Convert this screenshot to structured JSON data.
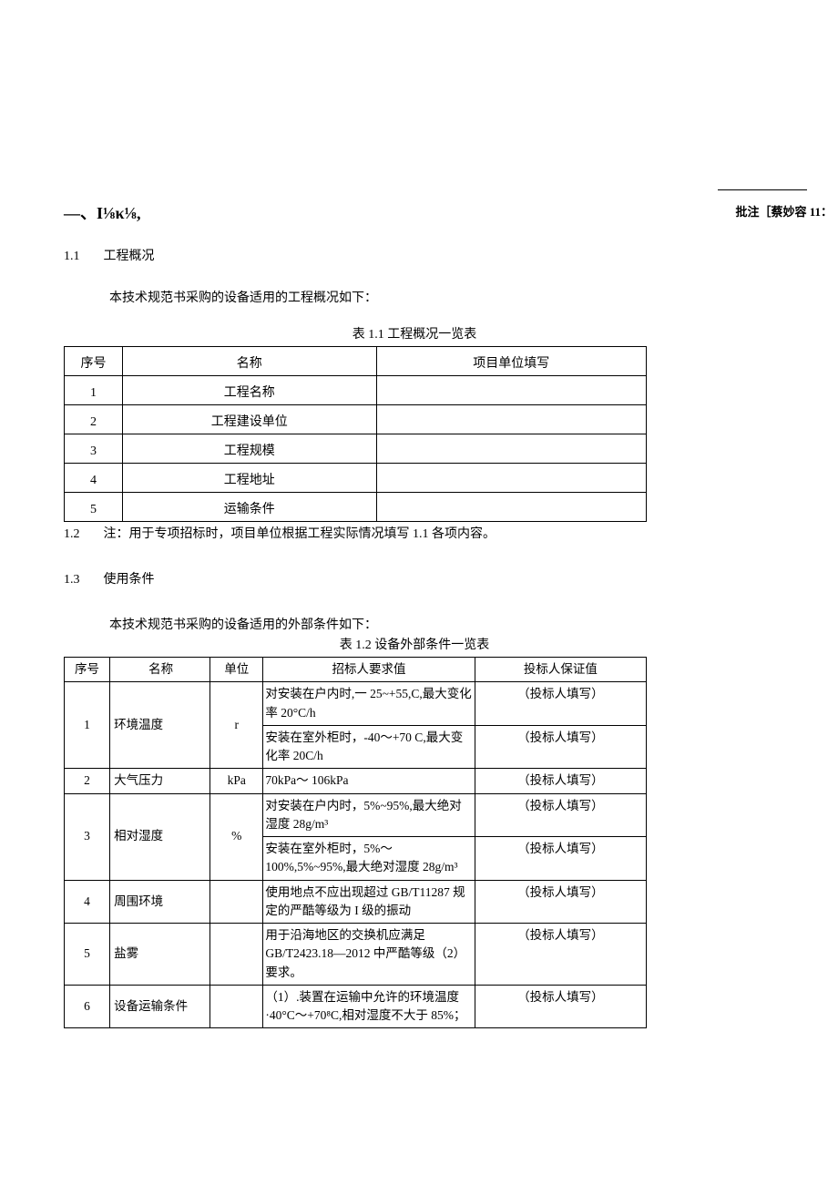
{
  "comment": {
    "label": "批注［蔡妙容 11："
  },
  "heading1": "—、I⅛κ⅛,",
  "sec11": {
    "num": "1.1",
    "title": "工程概况"
  },
  "intro11": "本技术规范书采购的设备适用的工程概况如下：",
  "table1": {
    "caption": "表 1.1 工程概况一览表",
    "headers": {
      "seq": "序号",
      "name": "名称",
      "fill": "项目单位填写"
    },
    "rows": [
      {
        "seq": "1",
        "name": "工程名称",
        "fill": ""
      },
      {
        "seq": "2",
        "name": "工程建设单位",
        "fill": ""
      },
      {
        "seq": "3",
        "name": "工程规模",
        "fill": ""
      },
      {
        "seq": "4",
        "name": "工程地址",
        "fill": ""
      },
      {
        "seq": "5",
        "name": "运输条件",
        "fill": ""
      }
    ]
  },
  "sec12": {
    "num": "1.2",
    "text": "注：用于专项招标时，项目单位根据工程实际情况填写 1.1 各项内容。"
  },
  "sec13": {
    "num": "1.3",
    "title": "使用条件"
  },
  "intro13": "本技术规范书采购的设备适用的外部条件如下：",
  "table2": {
    "caption": "表 1.2 设备外部条件一览表",
    "headers": {
      "seq": "序号",
      "name": "名称",
      "unit": "单位",
      "req": "招标人要求值",
      "guar": "投标人保证值"
    },
    "rows": [
      {
        "seq": "1",
        "name": "环境温度",
        "unit": "r",
        "reqs": [
          "对安装在户内时,一 25~+55,C,最大变化率 20°C/h",
          "安装在室外柜时，-40～+70 C,最大变化率 20C/h"
        ],
        "guars": [
          "（投标人填写）",
          "（投标人填写）"
        ]
      },
      {
        "seq": "2",
        "name": "大气压力",
        "unit": "kPa",
        "reqs": [
          "70kPa～ 106kPa"
        ],
        "guars": [
          "（投标人填写）"
        ]
      },
      {
        "seq": "3",
        "name": "相对湿度",
        "unit": "%",
        "reqs": [
          "对安装在户内时，5%~95%,最大绝对湿度 28g/m³",
          "安装在室外柜时，5%～100%,5%~95%,最大绝对湿度 28g/m³"
        ],
        "guars": [
          "（投标人填写）",
          "（投标人填写）"
        ]
      },
      {
        "seq": "4",
        "name": "周围环境",
        "unit": "",
        "reqs": [
          "使用地点不应出现超过 GB/T11287 规定的严酷等级为 I 级的振动"
        ],
        "guars": [
          "（投标人填写）"
        ]
      },
      {
        "seq": "5",
        "name": "盐雾",
        "unit": "",
        "reqs": [
          "用于沿海地区的交换机应满足 GB/T2423.18—2012 中严酷等级（2）要求。"
        ],
        "guars": [
          "（投标人填写）"
        ]
      },
      {
        "seq": "6",
        "name": "设备运输条件",
        "unit": "",
        "reqs": [
          "（1）.装置在运输中允许的环境温度·40°C～+70⁸C,相对湿度不大于 85%；"
        ],
        "guars": [
          "（投标人填写）"
        ]
      }
    ]
  }
}
